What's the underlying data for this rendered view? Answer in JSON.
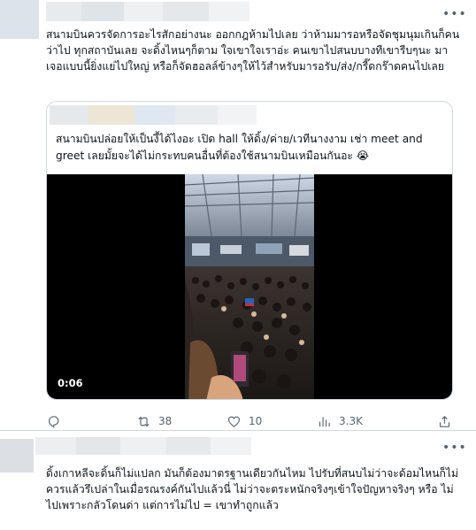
{
  "tweet": {
    "text": "สนามบินควรจัดการอะไรสักอย่างนะ ออกกฎห้ามไปเลย ว่าห้ามมารอหรือจัดชุมนุมเกินก็คนว่าไป ทุกสถาบันเลย จะดิ้งไหนๆก็ตาม ใจเขาใจเราอ่ะ คนเขาไปสนบบางทีเขารีบๆนะ มาเจอแบบนี้ยิ่งแย่ไปใหญ่ หรือก็จัดฮอลล์ข้างๆให้ไว้สำหรับมารอรับ/ส่ง/กรี๊ดกร๊าดคนไปเลย",
    "quote": {
      "text": "สนามบินปล่อยให้เป็นงี้ได้ไงอะ เปิด hall ให้ดิ้ง/ค่าย/เวทีนางงาม เช่า meet and greet เลยมั้ยจะได้ไม่กระทบคนอื่นที่ต้องใช้สนามบินเหมือนกันอะ 😭",
      "video_time": "0:06"
    },
    "actions": {
      "reply_count": "",
      "retweet_count": "38",
      "like_count": "10",
      "view_count": "3.3K"
    }
  },
  "reply": {
    "text": "ดิ้งเกาหลีจะดิ้นก็ไม่แปลก มันก็ต้องมาตรฐานเดียวกันไหม ไปรับที่สนบไม่ว่าจะด้อมไหนก็ไม่ควรแล้วรึเปล่าในเมื่อรณรงค์กันไปแล้วนี่ ไม่ว่าจะตระหนักจริงๆเข้าใจปัญหาจริงๆ หรือ ไม่ไปเพราะกลัวโดนด่า แต่การไม่ไป = เขาทำถูกแล้ว"
  },
  "icons": {
    "more": "more-icon",
    "reply": "reply-icon",
    "retweet": "retweet-icon",
    "like": "heart-icon",
    "views": "views-icon",
    "share": "share-icon"
  },
  "colors": {
    "text": "#0f1419",
    "secondary": "#536471",
    "border": "#cfd9de"
  }
}
